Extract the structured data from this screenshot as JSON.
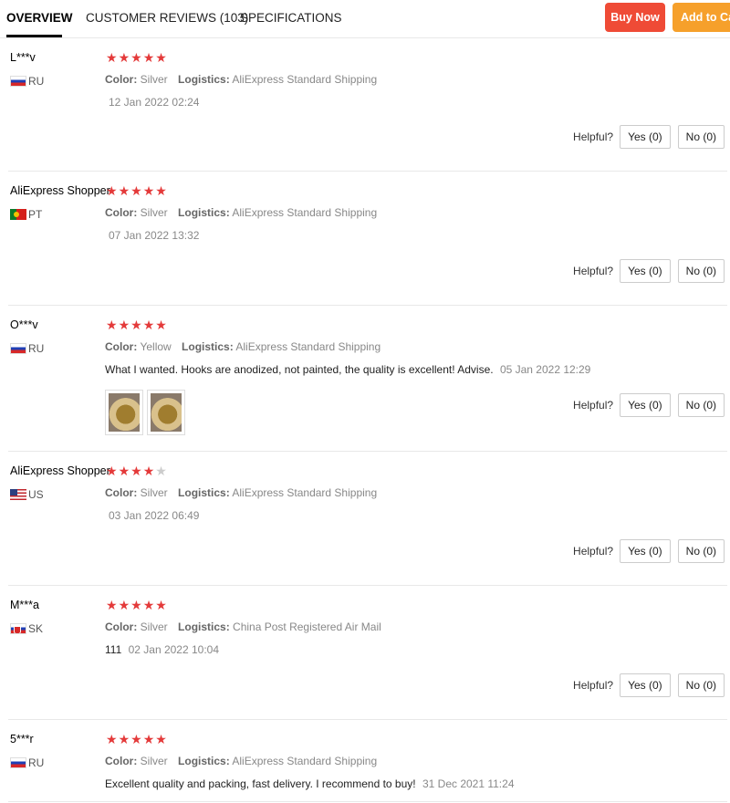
{
  "tabs": [
    {
      "label": "OVERVIEW",
      "active": true
    },
    {
      "label": "CUSTOMER REVIEWS (103)",
      "active": false
    },
    {
      "label": "SPECIFICATIONS",
      "active": false
    }
  ],
  "actions": {
    "buy_now": "Buy Now",
    "add_to_cart": "Add to Cart"
  },
  "labels": {
    "color": "Color:",
    "logistics": "Logistics:",
    "helpful": "Helpful?"
  },
  "colors": {
    "star": "#e43a3a",
    "star_empty": "#cccccc",
    "buy_now": "#ef4b36",
    "add_to_cart": "#f6a02b"
  },
  "reviews": [
    {
      "user": "L***v",
      "country": "RU",
      "flag": "russia-flag-icon",
      "rating": 5,
      "color": "Silver",
      "logistics": "AliExpress Standard Shipping",
      "text": "",
      "date": "12 Jan 2022 02:24",
      "yes": "Yes (0)",
      "no": "No (0)",
      "photos": 0
    },
    {
      "user": "AliExpress Shopper",
      "country": "PT",
      "flag": "portugal-flag-icon",
      "rating": 5,
      "color": "Silver",
      "logistics": "AliExpress Standard Shipping",
      "text": "",
      "date": "07 Jan 2022 13:32",
      "yes": "Yes (0)",
      "no": "No (0)",
      "photos": 0
    },
    {
      "user": "O***v",
      "country": "RU",
      "flag": "russia-flag-icon",
      "rating": 5,
      "color": "Yellow",
      "logistics": "AliExpress Standard Shipping",
      "text": "What I wanted. Hooks are anodized, not painted, the quality is excellent! Advise.",
      "date": "05 Jan 2022 12:29",
      "yes": "Yes (0)",
      "no": "No (0)",
      "photos": 2
    },
    {
      "user": "AliExpress Shopper",
      "country": "US",
      "flag": "usa-flag-icon",
      "rating": 4,
      "color": "Silver",
      "logistics": "AliExpress Standard Shipping",
      "text": "",
      "date": "03 Jan 2022 06:49",
      "yes": "Yes (0)",
      "no": "No (0)",
      "photos": 0
    },
    {
      "user": "M***a",
      "country": "SK",
      "flag": "slovakia-flag-icon",
      "rating": 5,
      "color": "Silver",
      "logistics": "China Post Registered Air Mail",
      "text": "111",
      "date": "02 Jan 2022 10:04",
      "yes": "Yes (0)",
      "no": "No (0)",
      "photos": 0
    },
    {
      "user": "5***r",
      "country": "RU",
      "flag": "russia-flag-icon",
      "rating": 5,
      "color": "Silver",
      "logistics": "AliExpress Standard Shipping",
      "text": "Excellent quality and packing, fast delivery. I recommend to buy!",
      "date": "31 Dec 2021 11:24",
      "yes": "",
      "no": "",
      "photos": 0
    }
  ]
}
